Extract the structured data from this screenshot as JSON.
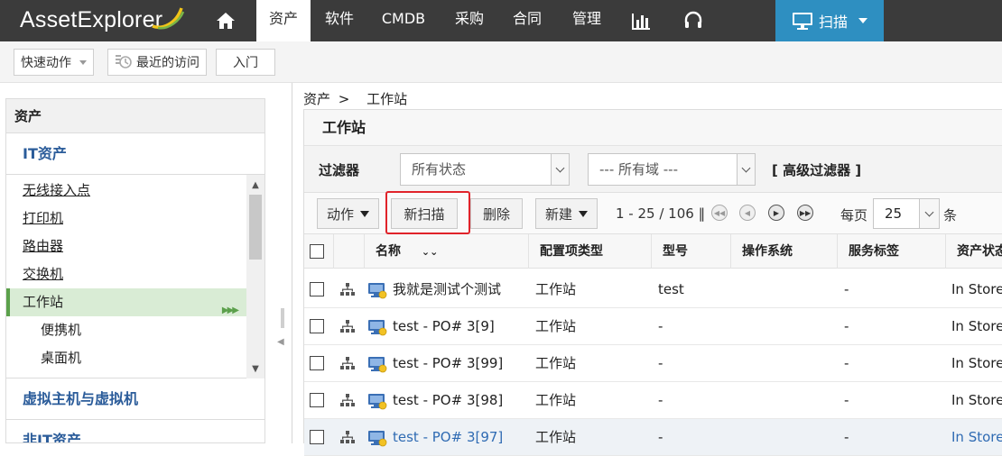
{
  "app": {
    "logo_text": "AssetExplorer",
    "nav": [
      "资产",
      "软件",
      "CMDB",
      "采购",
      "合同",
      "管理"
    ],
    "active_nav": "资产",
    "scan_label": "扫描"
  },
  "toolbar": {
    "quick_actions": "快速动作",
    "recent": "最近的访问",
    "getting_started": "入门"
  },
  "sidebar": {
    "header": "资产",
    "section_it": "IT资产",
    "items": [
      {
        "label": "无线接入点",
        "sub": false,
        "active": false
      },
      {
        "label": "打印机",
        "sub": false,
        "active": false
      },
      {
        "label": "路由器",
        "sub": false,
        "active": false
      },
      {
        "label": "交换机",
        "sub": false,
        "active": false
      },
      {
        "label": "工作站",
        "sub": false,
        "active": true
      },
      {
        "label": "便携机",
        "sub": true,
        "active": false
      },
      {
        "label": "桌面机",
        "sub": true,
        "active": false
      }
    ],
    "section_vm": "虚拟主机与虚拟机",
    "section_non_it": "非IT资产"
  },
  "breadcrumb": {
    "root": "资产",
    "sep": ">",
    "current": "工作站"
  },
  "panel": {
    "title": "工作站",
    "filter_label": "过滤器",
    "status_select": "所有状态",
    "domain_select": "--- 所有域 ---",
    "advanced_filter": "[ 高级过滤器 ]"
  },
  "actions": {
    "action": "动作",
    "new_scan": "新扫描",
    "delete": "删除",
    "new": "新建",
    "range": "1 - 25 / 106",
    "per_page_label": "每页",
    "per_page_value": "25",
    "unit": "条"
  },
  "table": {
    "columns": [
      "名称",
      "配置项类型",
      "型号",
      "操作系统",
      "服务标签",
      "资产状态"
    ],
    "rows": [
      {
        "name": "我就是测试个测试",
        "ci_type": "工作站",
        "model": "test",
        "os": "",
        "service_tag": "-",
        "status": "In Store"
      },
      {
        "name": "test - PO# 3[9]",
        "ci_type": "工作站",
        "model": "-",
        "os": "",
        "service_tag": "-",
        "status": "In Store"
      },
      {
        "name": "test - PO# 3[99]",
        "ci_type": "工作站",
        "model": "-",
        "os": "",
        "service_tag": "-",
        "status": "In Store"
      },
      {
        "name": "test - PO# 3[98]",
        "ci_type": "工作站",
        "model": "-",
        "os": "",
        "service_tag": "-",
        "status": "In Store"
      },
      {
        "name": "test - PO# 3[97]",
        "ci_type": "工作站",
        "model": "-",
        "os": "",
        "service_tag": "-",
        "status": "In Store"
      }
    ]
  },
  "colors": {
    "topbar": "#3b3b3b",
    "scan_button": "#2e8fc1",
    "highlight": "#e0232a",
    "active_item": "#d9ecd5",
    "link": "#2f6bb3"
  }
}
